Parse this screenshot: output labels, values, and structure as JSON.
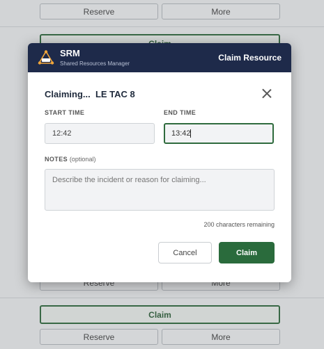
{
  "background": {
    "rows": [
      {
        "reserve": "Reserve",
        "more": "More"
      },
      {
        "claim": "Claim"
      },
      {
        "reserve": "Reserve",
        "more": "More"
      },
      {
        "claim": "Claim"
      },
      {
        "reserve": "Reserve",
        "more": "More"
      }
    ]
  },
  "modal": {
    "brand": {
      "name": "SRM",
      "subtitle": "Shared Resources Manager"
    },
    "header_title": "Claim Resource",
    "title": "Claiming...  LE TAC 8",
    "start_time": {
      "label": "START TIME",
      "value": "12:42"
    },
    "end_time": {
      "label": "END TIME",
      "value": "13:42"
    },
    "notes": {
      "label": "NOTES",
      "optional": "(optional)",
      "placeholder": "Describe the incident or reason for claiming..."
    },
    "chars_remaining": "200 characters remaining",
    "cancel_label": "Cancel",
    "claim_label": "Claim"
  },
  "colors": {
    "header": "#1e2a4a",
    "accent": "#2a6b3c"
  }
}
